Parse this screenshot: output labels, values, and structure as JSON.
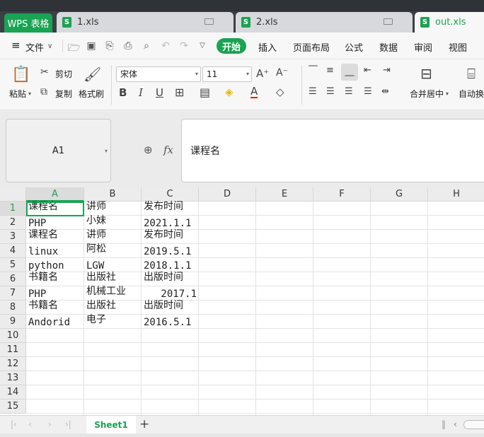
{
  "app_tab": "WPS 表格",
  "doc_tabs": [
    {
      "label": "1.xls",
      "icon": "S"
    },
    {
      "label": "2.xls",
      "icon": "S"
    },
    {
      "label": "out.xls",
      "icon": "S"
    }
  ],
  "menu": {
    "file": "文件",
    "start": "开始",
    "items": [
      "插入",
      "页面布局",
      "公式",
      "数据",
      "审阅",
      "视图"
    ]
  },
  "ribbon": {
    "paste": "粘贴",
    "cut": "剪切",
    "copy": "复制",
    "format_painter": "格式刷",
    "font_name": "宋体",
    "font_size": "11",
    "merge_center": "合并居中",
    "wrap": "自动换"
  },
  "name_box": "A1",
  "fx": "fx",
  "formula": "课程名",
  "columns": [
    "A",
    "B",
    "C",
    "D",
    "E",
    "F",
    "G",
    "H"
  ],
  "rows": [
    "1",
    "2",
    "3",
    "4",
    "5",
    "6",
    "7",
    "8",
    "9",
    "10",
    "11",
    "12",
    "13",
    "14",
    "15"
  ],
  "cells": {
    "r1": [
      "课程名",
      "讲师",
      "发布时间"
    ],
    "r2": [
      "PHP",
      "小妹",
      "2021.1.1"
    ],
    "r3": [
      "课程名",
      "讲师",
      "发布时间"
    ],
    "r4": [
      "linux",
      "阿松",
      "2019.5.1"
    ],
    "r5": [
      "python",
      "LGW",
      "2018.1.1"
    ],
    "r6": [
      "书籍名",
      "出版社",
      "出版时间"
    ],
    "r7": [
      "PHP",
      "机械工业",
      "2017.1"
    ],
    "r8": [
      "书籍名",
      "出版社",
      "出版时间"
    ],
    "r9": [
      "Andorid",
      "电子",
      "2016.5.1"
    ]
  },
  "sheet_tab": "Sheet1",
  "colors": {
    "accent": "#1aa352",
    "titlebar": "#3b3f46"
  }
}
